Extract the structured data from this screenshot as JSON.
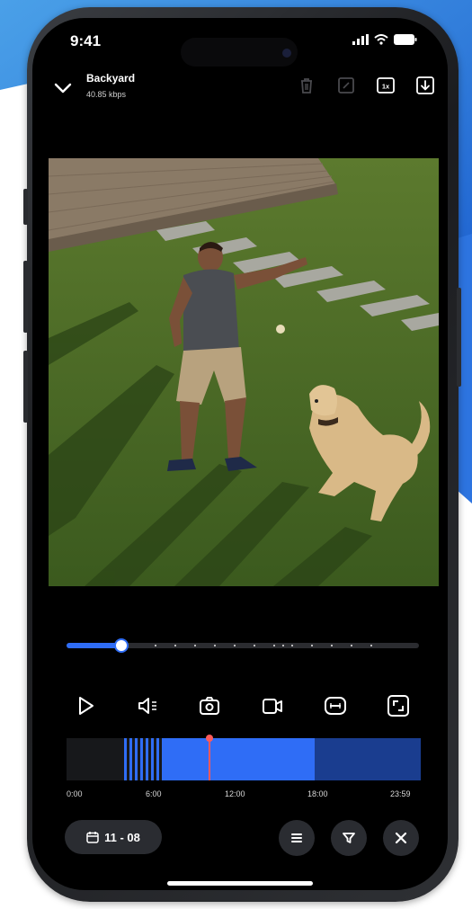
{
  "status_bar": {
    "time": "9:41",
    "icons": [
      "signal-icon",
      "wifi-icon",
      "battery-icon"
    ]
  },
  "header": {
    "camera_name": "Backyard",
    "bitrate": "40.85 kbps",
    "icons": [
      "chevron-down-icon",
      "trash-icon",
      "edit-icon",
      "speed-1x-icon",
      "download-icon"
    ],
    "speed_label": "1x"
  },
  "scrubber": {
    "progress": 0.155
  },
  "controls": {
    "icons": [
      "play-icon",
      "volume-icon",
      "camera-snapshot-icon",
      "record-video-icon",
      "hd-icon",
      "fullscreen-icon"
    ]
  },
  "timeline": {
    "labels": [
      "0:00",
      "6:00",
      "12:00",
      "18:00",
      "23:59"
    ],
    "marker_position": 0.4
  },
  "bottom_bar": {
    "date": "11 - 08",
    "icons": [
      "calendar-icon",
      "list-icon",
      "filter-icon",
      "close-icon"
    ]
  },
  "colors": {
    "accent": "#2f6df6",
    "timeline_dark": "#1a3d8f",
    "marker": "#ff5a5a",
    "background": "#000000"
  }
}
